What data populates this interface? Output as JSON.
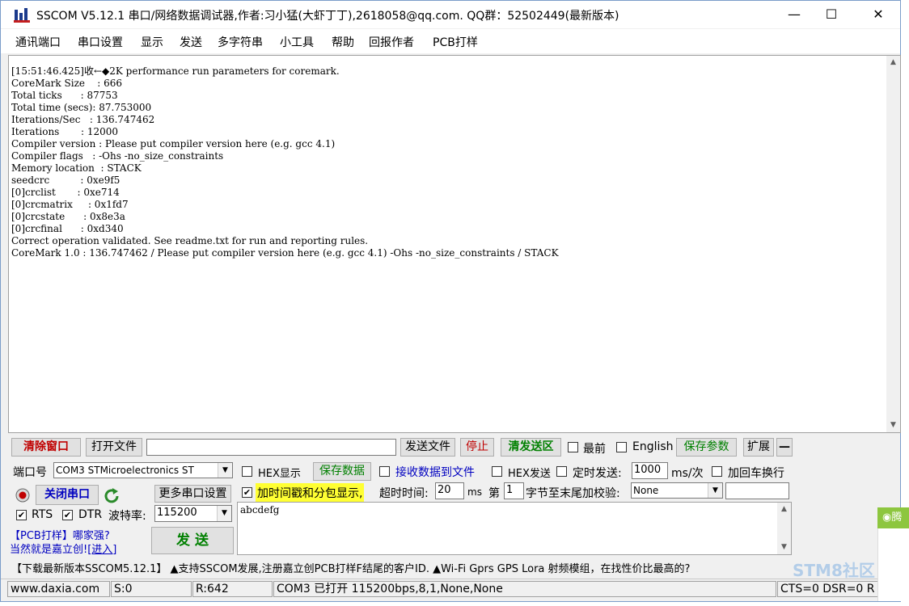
{
  "window": {
    "title": "SSCOM V5.12.1 串口/网络数据调试器,作者:习小猛(大虾丁丁),2618058@qq.com. QQ群：52502449(最新版本)",
    "minimize": "—",
    "maximize": "☐",
    "close": "✕"
  },
  "menu": [
    {
      "label": "通讯端口"
    },
    {
      "label": "串口设置"
    },
    {
      "label": "显示"
    },
    {
      "label": "发送"
    },
    {
      "label": "多字符串"
    },
    {
      "label": "小工具"
    },
    {
      "label": "帮助"
    },
    {
      "label": "回报作者"
    },
    {
      "label": "PCB打样"
    }
  ],
  "output": {
    "text": "[15:51:46.425]收←◆2K performance run parameters for coremark.\nCoreMark Size    : 666\nTotal ticks      : 87753\nTotal time (secs): 87.753000\nIterations/Sec   : 136.747462\nIterations       : 12000\nCompiler version : Please put compiler version here (e.g. gcc 4.1)\nCompiler flags   : -Ohs -no_size_constraints\nMemory location  : STACK\nseedcrc          : 0xe9f5\n[0]crclist       : 0xe714\n[0]crcmatrix     : 0x1fd7\n[0]crcstate      : 0x8e3a\n[0]crcfinal      : 0xd340\nCorrect operation validated. See readme.txt for run and reporting rules.\nCoreMark 1.0 : 136.747462 / Please put compiler version here (e.g. gcc 4.1) -Ohs -no_size_constraints / STACK"
  },
  "toolbar": {
    "clear_window": "清除窗口",
    "open_file": "打开文件",
    "file_path": "",
    "send_file": "发送文件",
    "stop": "停止",
    "clear_send": "清发送区",
    "top_most": "最前",
    "english": "English",
    "save_params": "保存参数",
    "expand": "扩展",
    "collapse": "—"
  },
  "port": {
    "port_label": "端口号",
    "port_value": "COM3 STMicroelectronics ST",
    "hex_display": "HEX显示",
    "save_data": "保存数据",
    "recv_to_file": "接收数据到文件",
    "hex_send": "HEX发送",
    "timed_send": "定时发送:",
    "interval": "1000",
    "interval_unit": "ms/次",
    "append_newline": "加回车换行",
    "close_port": "关闭串口",
    "more_settings": "更多串口设置",
    "timestamp": "加时间戳和分包显示,",
    "timeout_label": "超时时间:",
    "timeout_value": "20",
    "timeout_unit": "ms",
    "byte_prefix": "第",
    "byte_index": "1",
    "byte_suffix": "字节至末尾加校验:",
    "checksum": "None",
    "rts": "RTS",
    "dtr": "DTR",
    "baud_label": "波特率:",
    "baud_value": "115200",
    "send_text": "abcdefg",
    "promo_line1": "【PCB打样】哪家强?",
    "promo_line2": "当然就是嘉立创!",
    "promo_link": "[进入]",
    "send_button": "发  送"
  },
  "marquee": "【下载最新版本SSCOM5.12.1】  ▲支持SSCOM发展,注册嘉立创PCB打样F结尾的客户ID. ▲Wi-Fi Gprs GPS Lora 射频模组，在找性价比最高的?",
  "status": {
    "website": "www.daxia.com",
    "sent": "S:0",
    "received": "R:642",
    "port_state": "COM3 已打开  115200bps,8,1,None,None",
    "signals": "CTS=0 DSR=0 R"
  },
  "side": {
    "notification": "腾",
    "watermark": "STM8社区"
  }
}
